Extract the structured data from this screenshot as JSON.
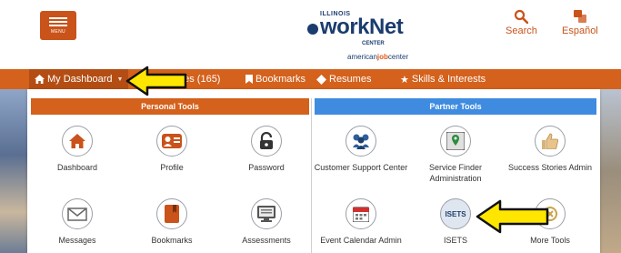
{
  "header": {
    "menu_label": "MENU",
    "logo": {
      "illinois": "ILLINOIS",
      "work": "workNet",
      "center": "CENTER",
      "ajc_prefix": "american",
      "ajc_bold": "job",
      "ajc_suffix": "center"
    },
    "search_label": "Search",
    "lang_label": "Español"
  },
  "nav": {
    "dashboard": "My Dashboard",
    "messages": "ges (165)",
    "bookmarks": "Bookmarks",
    "resumes": "Resumes",
    "skills": "Skills & Interests"
  },
  "panel": {
    "personal_title": "Personal Tools",
    "partner_title": "Partner Tools",
    "personal_tools": [
      {
        "label": "Dashboard",
        "icon": "home-icon"
      },
      {
        "label": "Profile",
        "icon": "profile-card-icon"
      },
      {
        "label": "Password",
        "icon": "lock-icon"
      },
      {
        "label": "Messages",
        "icon": "envelope-icon"
      },
      {
        "label": "Bookmarks",
        "icon": "bookmark-book-icon"
      },
      {
        "label": "Assessments",
        "icon": "computer-checklist-icon"
      }
    ],
    "partner_tools": [
      {
        "label": "Customer Support Center",
        "icon": "support-people-icon"
      },
      {
        "label": "Service Finder Administration",
        "icon": "map-pin-icon"
      },
      {
        "label": "Success Stories Admin",
        "icon": "thumbs-up-icon"
      },
      {
        "label": "Event Calendar Admin",
        "icon": "calendar-icon"
      },
      {
        "label": "ISETS",
        "icon": "isets-logo-icon",
        "logo_text": "ISETS"
      },
      {
        "label": "More Tools",
        "icon": "more-tools-icon"
      }
    ]
  },
  "colors": {
    "brand_orange": "#d4611c",
    "partner_blue": "#3f8be0",
    "logo_navy": "#1a3c6e",
    "arrow_yellow": "#ffe600"
  }
}
